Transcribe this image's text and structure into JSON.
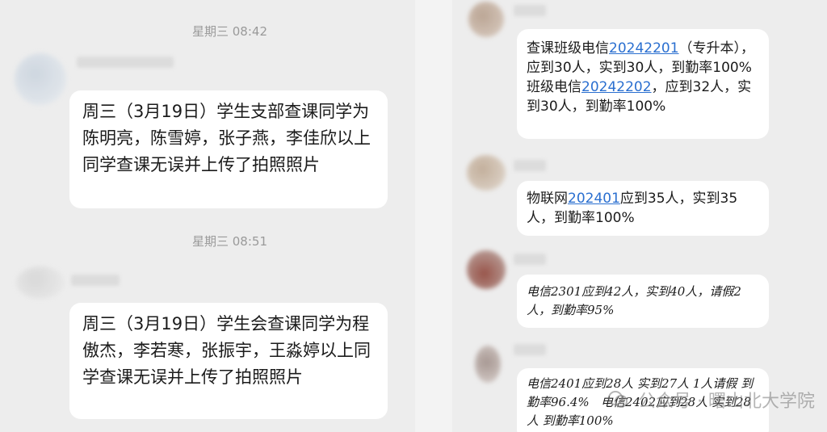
{
  "left": {
    "timestamp_1": "星期三 08:42",
    "timestamp_2": "星期三 08:51",
    "message_1": "周三（3月19日）学生支部查课同学为陈明亮，陈雪婷，张子燕，李佳欣以上同学查课无误并上传了拍照照片",
    "message_2": "周三（3月19日）学生会查课同学为程傲杰，李若寒，张振宇，王淼婷以上同学查课无误并上传了拍照照片"
  },
  "right": {
    "msg_1": {
      "p1": "查课班级电信",
      "link1": "20242201",
      "p2": "（专升本），应到30人，实到30人，到勤率100%\n班级电信",
      "link2": "20242202",
      "p3": "，应到32人，实到30人，到勤率100%"
    },
    "msg_2": {
      "p1": "物联网",
      "link1": "202401",
      "p2": "应到35人，实到35人，到勤率100%"
    },
    "msg_3": "电信2301应到42人，实到40人，请假2人，到勤率95%",
    "msg_4": "电信2401应到28人 实到27人 1人请假 到勤率96.4%   电信2402应到28人 实到28人 到勤率100%"
  },
  "watermark": "公众号 · 曙山北大学院",
  "colors": {
    "link": "#2a6fd0",
    "background": "#ededed",
    "bubble": "#ffffff",
    "timestamp": "#9a9a9a"
  }
}
